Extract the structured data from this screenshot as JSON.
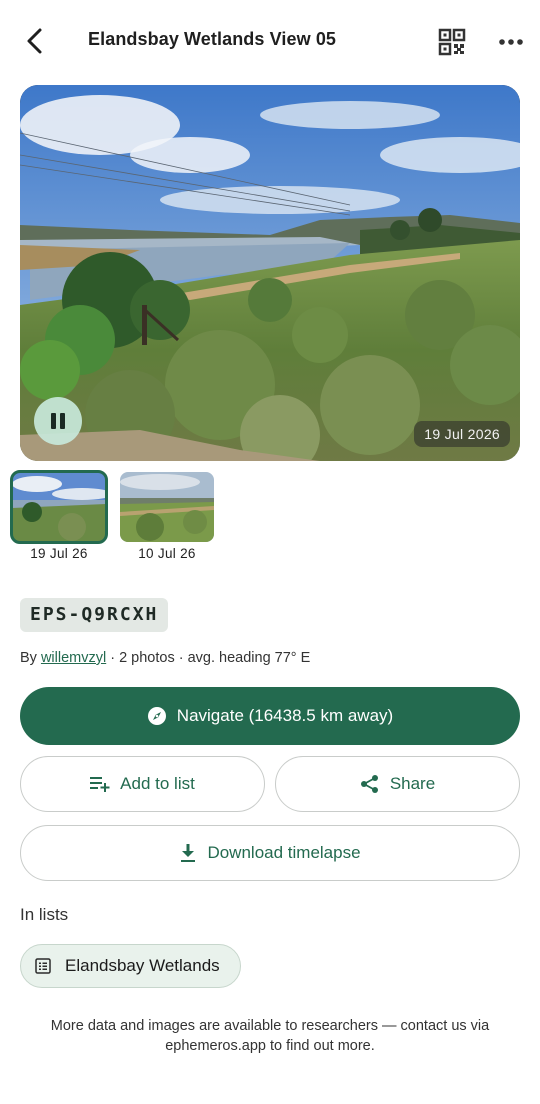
{
  "appbar": {
    "title": "Elandsbay Wetlands View 05"
  },
  "hero": {
    "date": "19 Jul 2026"
  },
  "thumbnails": [
    {
      "date": "19 Jul 26",
      "selected": true
    },
    {
      "date": "10 Jul 26",
      "selected": false
    }
  ],
  "details": {
    "code": "EPS-Q9RCXH",
    "by_prefix": "By ",
    "author": "willemvzyl",
    "stats": " · 2 photos · avg. heading 77° E"
  },
  "actions": {
    "navigate_label": "Navigate (16438.5 km away)",
    "add_to_list_label": "Add to list",
    "share_label": "Share",
    "download_label": "Download timelapse"
  },
  "lists": {
    "title": "In lists",
    "items": [
      {
        "label": "Elandsbay Wetlands"
      }
    ]
  },
  "footer": {
    "text": "More data and images are available to researchers — contact us via ephemeros.app to find out more."
  },
  "colors": {
    "accent": "#236a4f",
    "chip_bg": "#e9f2ec"
  }
}
